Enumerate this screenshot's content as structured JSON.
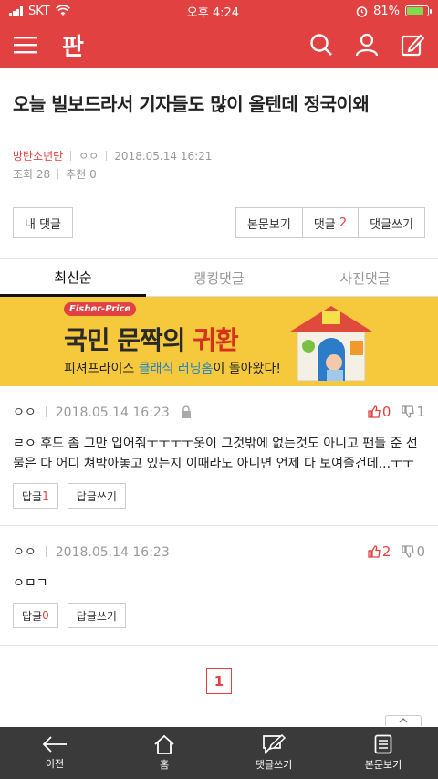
{
  "status": {
    "carrier": "SKT",
    "time": "오후 4:24",
    "battery": "81%",
    "battery_level": 0.81
  },
  "header": {
    "logo": "판"
  },
  "post": {
    "title": "오늘 빌보드라서 기자들도 많이 올텐데 정국이왜",
    "author": "방탄소년단",
    "nick": "ㅇㅇ",
    "date": "2018.05.14 16:21",
    "views": "조회 28",
    "recommend": "추천 0"
  },
  "buttons": {
    "my_comments": "내 댓글",
    "view_body": "본문보기",
    "comments_label": "댓글",
    "comments_count": "2",
    "write_comment": "댓글쓰기"
  },
  "tabs": [
    "최신순",
    "랭킹댓글",
    "사진댓글"
  ],
  "banner": {
    "brand": "Fisher-Price",
    "headline_a": "국민 문짝의 ",
    "headline_b": "귀환",
    "sub_a": "피셔프라이스 ",
    "sub_b": "클래식 러닝홈",
    "sub_c": "이 돌아왔다!"
  },
  "comments": [
    {
      "nick": "ㅇㅇ",
      "date": "2018.05.14 16:23",
      "up": "0",
      "down": "1",
      "body": "ㄹㅇ 후드 좀 그만 입어줘ㅜㅜㅜㅜ옷이 그것밖에 없는것도 아니고 팬들 준 선물은 다 어디 쳐박아놓고 있는지 이때라도 아니면 언제 다 보여줄건데...ㅜㅜ",
      "reply_label": "답글",
      "reply_count": "1",
      "reply_write": "답글쓰기"
    },
    {
      "nick": "ㅇㅇ",
      "date": "2018.05.14 16:23",
      "up": "2",
      "down": "0",
      "body": "ㅇㅁㄱ",
      "reply_label": "답글",
      "reply_count": "0",
      "reply_write": "답글쓰기"
    }
  ],
  "pager": {
    "current": "1"
  },
  "bottom_nav": [
    "이전",
    "홈",
    "댓글쓰기",
    "본문보기"
  ],
  "colors": {
    "brand_red": "#e14140",
    "banner_yellow": "#f6c93d",
    "bottom_bar": "#3a3a3a"
  }
}
